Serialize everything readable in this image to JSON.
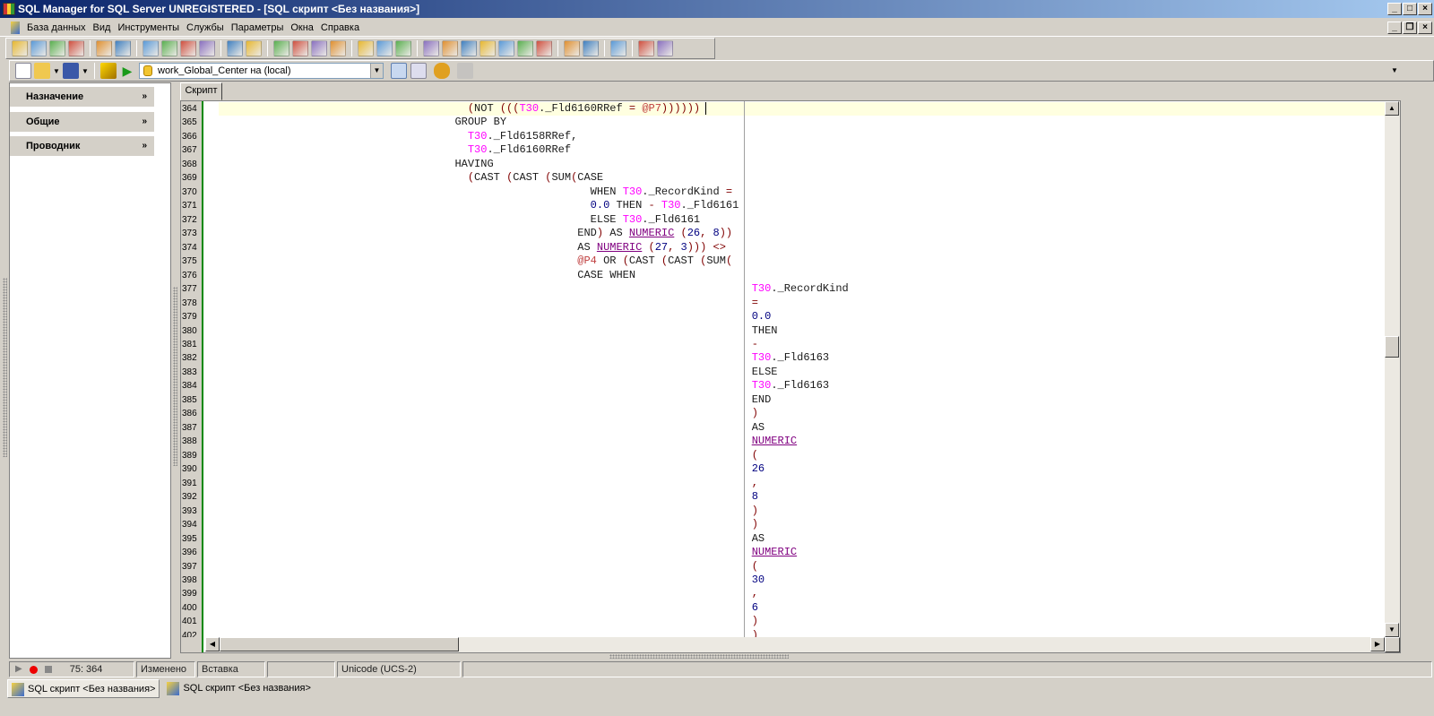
{
  "window": {
    "title": "SQL Manager for SQL Server UNREGISTERED - [SQL скрипт <Без названия>]"
  },
  "menu": [
    "База данных",
    "Вид",
    "Инструменты",
    "Службы",
    "Параметры",
    "Окна",
    "Справка"
  ],
  "toolbar1_icons": [
    "add-database-icon",
    "edit-database-icon",
    "remove-database-icon",
    "database-options-icon",
    "|",
    "connect-icon",
    "script-icon",
    "|",
    "query-edit-icon",
    "new-table-icon",
    "designer-icon",
    "add-field-icon",
    "|",
    "execute-script-icon",
    "new-object-icon",
    "|",
    "backup-icon",
    "print-icon",
    "export-icon",
    "tree-icon",
    "|",
    "grid-icon",
    "users-icon",
    "roles-icon",
    "|",
    "cascade-icon",
    "tile-horizontal-icon",
    "tile-vertical-icon",
    "maximize-window-icon",
    "close-windows-icon",
    "previous-window-icon",
    "next-window-icon",
    "|",
    "import-data-icon",
    "export-data-icon",
    "|",
    "settings-icon",
    "|",
    "open-folder-icon",
    "services-icon"
  ],
  "toolbar2": {
    "connection": "work_Global_Center на (local)"
  },
  "left_panel": {
    "sections": [
      "Назначение",
      "Общие",
      "Проводник"
    ]
  },
  "editor": {
    "tab": "Скрипт",
    "lines": [
      {
        "n": "364",
        "tokens": [
          [
            "                                       (",
            "p"
          ],
          [
            "NOT ",
            "k"
          ],
          [
            "(((",
            "p"
          ],
          [
            "T30",
            "t"
          ],
          [
            "._Fld6160RRef ",
            "i"
          ],
          [
            "= ",
            "p"
          ],
          [
            "@P7",
            "v"
          ],
          [
            "))))))",
            "p"
          ]
        ]
      },
      {
        "n": "365",
        "tokens": [
          [
            "                                     GROUP BY",
            "k"
          ]
        ]
      },
      {
        "n": "366",
        "tokens": [
          [
            "                                       T30",
            "t"
          ],
          [
            "._Fld6158RRef,",
            "i"
          ]
        ]
      },
      {
        "n": "367",
        "tokens": [
          [
            "                                       T30",
            "t"
          ],
          [
            "._Fld6160RRef",
            "i"
          ]
        ]
      },
      {
        "n": "368",
        "tokens": [
          [
            "                                     HAVING",
            "k"
          ]
        ]
      },
      {
        "n": "369",
        "tokens": [
          [
            "                                       (",
            "p"
          ],
          [
            "CAST ",
            "k"
          ],
          [
            "(",
            "p"
          ],
          [
            "CAST ",
            "k"
          ],
          [
            "(",
            "p"
          ],
          [
            "SUM",
            "k"
          ],
          [
            "(",
            "p"
          ],
          [
            "CASE",
            "k"
          ]
        ]
      },
      {
        "n": "370",
        "tokens": [
          [
            "                                                          WHEN ",
            "k"
          ],
          [
            "T30",
            "t"
          ],
          [
            "._RecordKind ",
            "i"
          ],
          [
            "=",
            "p"
          ]
        ]
      },
      {
        "n": "371",
        "tokens": [
          [
            "                                                          0.0 ",
            "n"
          ],
          [
            "THEN ",
            "k"
          ],
          [
            "- ",
            "p"
          ],
          [
            "T30",
            "t"
          ],
          [
            "._Fld6161",
            "i"
          ]
        ]
      },
      {
        "n": "372",
        "tokens": [
          [
            "                                                          ELSE ",
            "k"
          ],
          [
            "T30",
            "t"
          ],
          [
            "._Fld6161",
            "i"
          ]
        ]
      },
      {
        "n": "373",
        "tokens": [
          [
            "                                                        END",
            "k"
          ],
          [
            ") ",
            "p"
          ],
          [
            "AS ",
            "k"
          ],
          [
            "NUMERIC",
            "f"
          ],
          [
            " (",
            "p"
          ],
          [
            "26",
            "n"
          ],
          [
            ", ",
            "p"
          ],
          [
            "8",
            "n"
          ],
          [
            "))",
            "p"
          ]
        ]
      },
      {
        "n": "374",
        "tokens": [
          [
            "                                                        AS ",
            "k"
          ],
          [
            "NUMERIC",
            "f"
          ],
          [
            " (",
            "p"
          ],
          [
            "27",
            "n"
          ],
          [
            ", ",
            "p"
          ],
          [
            "3",
            "n"
          ],
          [
            "))) <>",
            "p"
          ]
        ]
      },
      {
        "n": "375",
        "tokens": [
          [
            "                                                        @P4 ",
            "v"
          ],
          [
            "OR ",
            "k"
          ],
          [
            "(",
            "p"
          ],
          [
            "CAST ",
            "k"
          ],
          [
            "(",
            "p"
          ],
          [
            "CAST ",
            "k"
          ],
          [
            "(",
            "p"
          ],
          [
            "SUM",
            "k"
          ],
          [
            "(",
            "p"
          ]
        ]
      },
      {
        "n": "376",
        "tokens": [
          [
            "                                                        CASE WHEN",
            "k"
          ]
        ]
      },
      {
        "n": "377",
        "tokens": [
          [
            "                                                                                   T30",
            "t"
          ],
          [
            "._RecordKind",
            "i"
          ]
        ]
      },
      {
        "n": "378",
        "tokens": [
          [
            "                                                                                   =",
            "p"
          ]
        ]
      },
      {
        "n": "379",
        "tokens": [
          [
            "                                                                                   0.0",
            "n"
          ]
        ]
      },
      {
        "n": "380",
        "tokens": [
          [
            "                                                                                   THEN",
            "k"
          ]
        ]
      },
      {
        "n": "381",
        "tokens": [
          [
            "                                                                                   -",
            "p"
          ]
        ]
      },
      {
        "n": "382",
        "tokens": [
          [
            "                                                                                   T30",
            "t"
          ],
          [
            "._Fld6163",
            "i"
          ]
        ]
      },
      {
        "n": "383",
        "tokens": [
          [
            "                                                                                   ELSE",
            "k"
          ]
        ]
      },
      {
        "n": "384",
        "tokens": [
          [
            "                                                                                   T30",
            "t"
          ],
          [
            "._Fld6163",
            "i"
          ]
        ]
      },
      {
        "n": "385",
        "tokens": [
          [
            "                                                                                   END",
            "k"
          ]
        ]
      },
      {
        "n": "386",
        "tokens": [
          [
            "                                                                                   )",
            "p"
          ]
        ]
      },
      {
        "n": "387",
        "tokens": [
          [
            "                                                                                   AS",
            "k"
          ]
        ]
      },
      {
        "n": "388",
        "tokens": [
          [
            "                                                                                   ",
            "i"
          ],
          [
            "NUMERIC",
            "f"
          ]
        ]
      },
      {
        "n": "389",
        "tokens": [
          [
            "                                                                                   (",
            "p"
          ]
        ]
      },
      {
        "n": "390",
        "tokens": [
          [
            "                                                                                   26",
            "n"
          ]
        ]
      },
      {
        "n": "391",
        "tokens": [
          [
            "                                                                                   ,",
            "p"
          ]
        ]
      },
      {
        "n": "392",
        "tokens": [
          [
            "                                                                                   8",
            "n"
          ]
        ]
      },
      {
        "n": "393",
        "tokens": [
          [
            "                                                                                   )",
            "p"
          ]
        ]
      },
      {
        "n": "394",
        "tokens": [
          [
            "                                                                                   )",
            "p"
          ]
        ]
      },
      {
        "n": "395",
        "tokens": [
          [
            "                                                                                   AS",
            "k"
          ]
        ]
      },
      {
        "n": "396",
        "tokens": [
          [
            "                                                                                   ",
            "i"
          ],
          [
            "NUMERIC",
            "f"
          ]
        ]
      },
      {
        "n": "397",
        "tokens": [
          [
            "                                                                                   (",
            "p"
          ]
        ]
      },
      {
        "n": "398",
        "tokens": [
          [
            "                                                                                   30",
            "n"
          ]
        ]
      },
      {
        "n": "399",
        "tokens": [
          [
            "                                                                                   ,",
            "p"
          ]
        ]
      },
      {
        "n": "400",
        "tokens": [
          [
            "                                                                                   6",
            "n"
          ]
        ]
      },
      {
        "n": "401",
        "tokens": [
          [
            "                                                                                   )",
            "p"
          ]
        ]
      },
      {
        "n": "402",
        "tokens": [
          [
            "                                                                                   )",
            "p"
          ]
        ]
      }
    ]
  },
  "status": {
    "position": "75:  364",
    "modified": "Изменено",
    "mode": "Вставка",
    "empty": "",
    "encoding": "Unicode (UCS-2)"
  },
  "taskbar": [
    "SQL скрипт <Без названия>",
    "SQL скрипт <Без названия>"
  ],
  "colors": {
    "title_start": "#0a246a",
    "title_end": "#a6caf0",
    "current_line": "#ffffe0",
    "gutter_mark": "#008000"
  }
}
